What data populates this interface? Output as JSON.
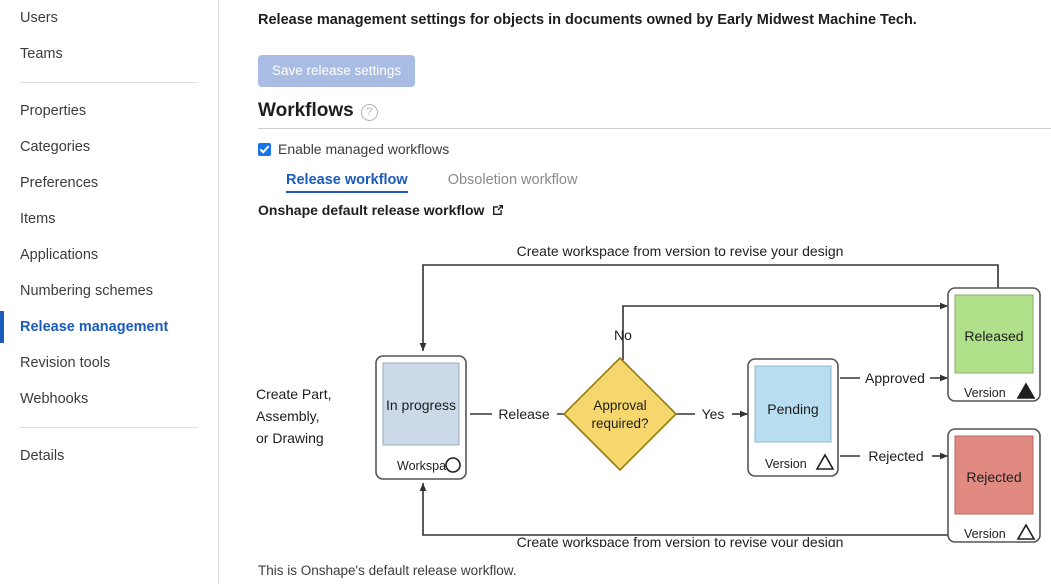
{
  "sidebar": {
    "groups": [
      {
        "items": [
          {
            "label": "Users",
            "active": false
          },
          {
            "label": "Teams",
            "active": false
          }
        ]
      },
      {
        "items": [
          {
            "label": "Properties",
            "active": false
          },
          {
            "label": "Categories",
            "active": false
          },
          {
            "label": "Preferences",
            "active": false
          },
          {
            "label": "Items",
            "active": false
          },
          {
            "label": "Applications",
            "active": false
          },
          {
            "label": "Numbering schemes",
            "active": false
          },
          {
            "label": "Release management",
            "active": true
          },
          {
            "label": "Revision tools",
            "active": false
          },
          {
            "label": "Webhooks",
            "active": false
          }
        ]
      },
      {
        "items": [
          {
            "label": "Details",
            "active": false
          }
        ]
      }
    ],
    "active_color": "#1a5bbd"
  },
  "main": {
    "description": "Release management settings for objects in documents owned by Early Midwest Machine Tech.",
    "save_button": "Save release settings",
    "section_title": "Workflows",
    "help_icon": "question-mark-icon",
    "enable_checkbox": {
      "label": "Enable managed workflows",
      "checked": true
    },
    "tabs": [
      {
        "label": "Release workflow",
        "active": true
      },
      {
        "label": "Obsoletion workflow",
        "active": false
      }
    ],
    "workflow_name": "Onshape default release workflow",
    "external_link_icon": "external-link-icon",
    "footnote": "This is Onshape's default release workflow."
  },
  "diagram": {
    "title": "Onshape default release workflow",
    "nodes": [
      {
        "id": "inprogress",
        "label": "In progress",
        "sublabel": "Workspace",
        "marker": "circle",
        "fill": "#ccd9e8"
      },
      {
        "id": "approval",
        "label": "Approval required?",
        "shape": "diamond",
        "fill": "#f5d76e"
      },
      {
        "id": "pending",
        "label": "Pending",
        "sublabel": "Version",
        "marker": "triangle-outline",
        "fill": "#b8dcf0"
      },
      {
        "id": "released",
        "label": "Released",
        "sublabel": "Version",
        "marker": "triangle-filled",
        "fill": "#b0e08a"
      },
      {
        "id": "rejected",
        "label": "Rejected",
        "sublabel": "Version",
        "marker": "triangle-outline",
        "fill": "#e08a82"
      }
    ],
    "edge_labels": {
      "start": "Create Part,\nAssembly,\nor Drawing",
      "start_line1": "Create Part,",
      "start_line2": "Assembly,",
      "start_line3": "or Drawing",
      "release": "Release",
      "no": "No",
      "yes": "Yes",
      "approved": "Approved",
      "rejected": "Rejected",
      "revise_top": "Create workspace from version to revise your design",
      "revise_bottom": "Create workspace from version to revise your design"
    },
    "stroke": "#333333"
  }
}
